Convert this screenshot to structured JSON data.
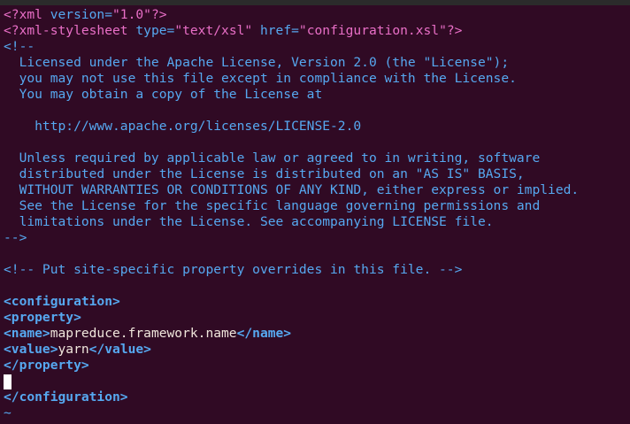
{
  "xml_decl": {
    "open": "<?xml ",
    "attr_name": "version=",
    "attr_value": "\"1.0\"",
    "close": "?>"
  },
  "stylesheet": {
    "open": "<?xml-stylesheet ",
    "type_name": "type=",
    "type_value": "\"text/xsl\"",
    "space": " ",
    "href_name": "href=",
    "href_value": "\"configuration.xsl\"",
    "close": "?>"
  },
  "license_comment": {
    "open": "<!--",
    "lines": [
      "  Licensed under the Apache License, Version 2.0 (the \"License\");",
      "  you may not use this file except in compliance with the License.",
      "  You may obtain a copy of the License at",
      "",
      "    http://www.apache.org/licenses/LICENSE-2.0",
      "",
      "  Unless required by applicable law or agreed to in writing, software",
      "  distributed under the License is distributed on an \"AS IS\" BASIS,",
      "  WITHOUT WARRANTIES OR CONDITIONS OF ANY KIND, either express or implied.",
      "  See the License for the specific language governing permissions and",
      "  limitations under the License. See accompanying LICENSE file."
    ],
    "close": "-->"
  },
  "site_comment": "<!-- Put site-specific property overrides in this file. -->",
  "config": {
    "open_tag": "<configuration>",
    "property_open": "<property>",
    "name_open": "<name>",
    "name_value": "mapreduce.framework.name",
    "name_close": "</name>",
    "value_open": "<value>",
    "value_value": "yarn",
    "value_close": "</value>",
    "property_close": "</property>",
    "close_tag": "</configuration>"
  },
  "tilde": "~"
}
